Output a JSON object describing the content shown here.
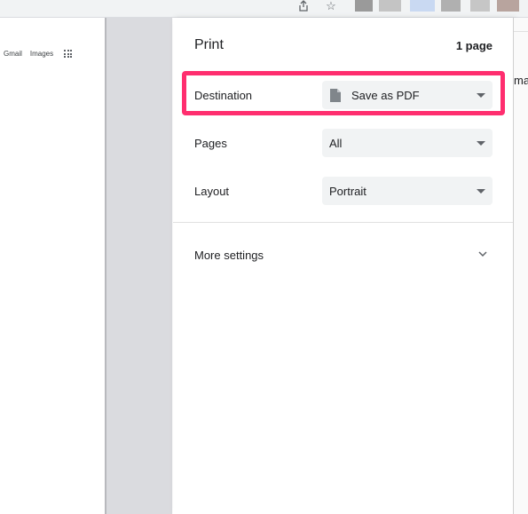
{
  "browser_toolbar": {
    "icons": [
      "share-icon",
      "bookmark-star-icon"
    ],
    "share_glyph": "⇧",
    "star_glyph": "☆"
  },
  "preview": {
    "links": [
      "Gmail",
      "Images"
    ],
    "apps_icon": "apps-grid-icon"
  },
  "print_dialog": {
    "title": "Print",
    "page_count": "1 page",
    "rows": [
      {
        "label": "Destination",
        "value": "Save as PDF",
        "icon": "file-icon",
        "highlighted": true
      },
      {
        "label": "Pages",
        "value": "All"
      },
      {
        "label": "Layout",
        "value": "Portrait"
      }
    ],
    "more_settings": "More settings"
  },
  "background_page": {
    "partial_text": "ma"
  },
  "colors": {
    "highlight": "#ff2e6f",
    "select_bg": "#f1f3f4",
    "gutter": "#dadbdf"
  }
}
